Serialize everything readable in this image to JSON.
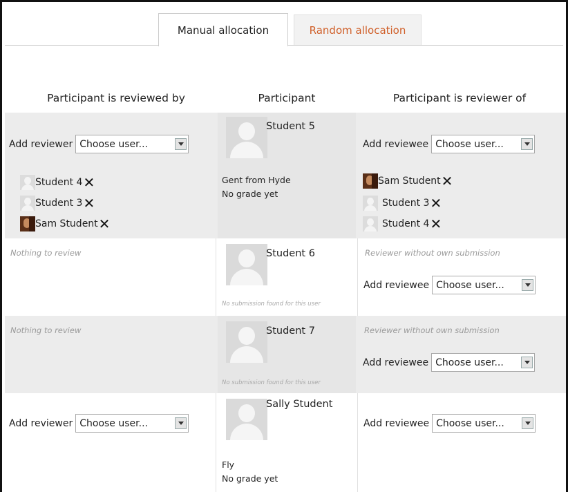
{
  "tabs": {
    "manual": "Manual allocation",
    "random": "Random allocation"
  },
  "headers": {
    "reviewed_by": "Participant is reviewed by",
    "participant": "Participant",
    "reviewer_of": "Participant is reviewer of"
  },
  "common": {
    "add_reviewer": "Add reviewer",
    "add_reviewee": "Add reviewee",
    "choose_user": "Choose user...",
    "nothing_to_review": "Nothing to review",
    "reviewer_without_submission": "Reviewer without own submission",
    "no_submission": "No submission found for this user",
    "remove_symbol": "✕"
  },
  "rows": [
    {
      "participant": "Student 5",
      "submission_title": "Gent from Hyde",
      "grade": "No grade yet",
      "reviewed_by": [
        "Student 4",
        "Student 3",
        "Sam Student"
      ],
      "reviewer_of": [
        "Sam Student",
        "Student 3",
        "Student 4"
      ]
    },
    {
      "participant": "Student 6"
    },
    {
      "participant": "Student 7"
    },
    {
      "participant": "Sally Student",
      "submission_title": "Fly",
      "grade": "No grade yet"
    }
  ],
  "colors": {
    "shade": "#ececec",
    "inactive_tab_text": "#d0602a"
  }
}
